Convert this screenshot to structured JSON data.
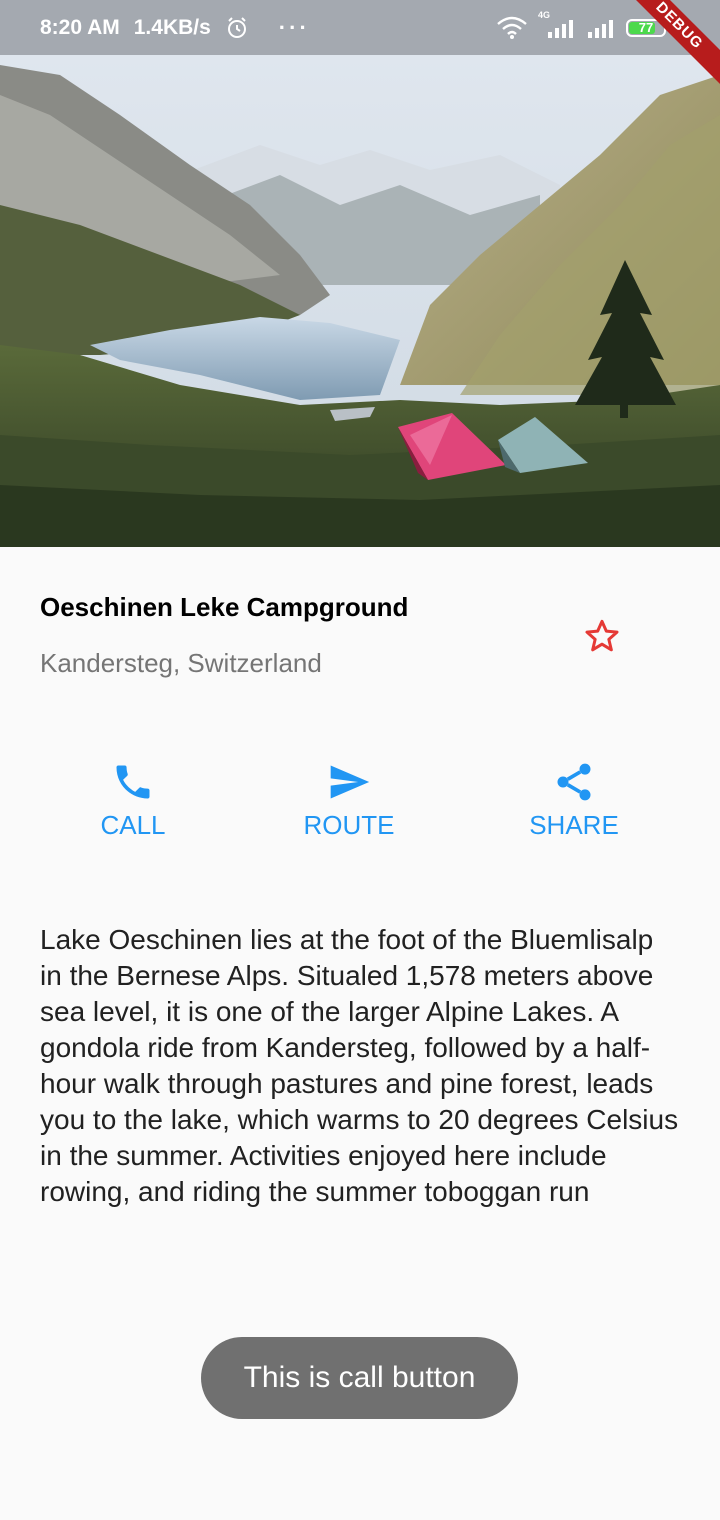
{
  "status_bar": {
    "time": "8:20 AM",
    "network_speed": "1.4KB/s",
    "more_indicator": "···",
    "battery_level": "77",
    "battery_fraction": 0.77,
    "network_type": "4G",
    "debug_banner": "DEBUG",
    "icons": [
      "alarm-icon",
      "wifi-icon",
      "signal-icon",
      "battery-icon",
      "charging-icon"
    ]
  },
  "place": {
    "title": "Oeschinen Leke Campground",
    "location": "Kandersteg, Switzerland",
    "favorite_icon": "star-outline-icon"
  },
  "actions": [
    {
      "label": "CALL",
      "icon": "phone-icon"
    },
    {
      "label": "ROUTE",
      "icon": "send-icon"
    },
    {
      "label": "SHARE",
      "icon": "share-icon"
    }
  ],
  "description": "Lake Oeschinen lies at the foot of the Bluemlisalp in the Bernese Alps. Situaled 1,578 meters above sea level, it is one of the larger Alpine Lakes. A gondola ride from Kandersteg, followed by a half-hour walk through pastures and pine forest, leads you to the lake, which warms to 20 degrees Celsius in the summer. Activities enjoyed here include rowing, and riding the summer toboggan run",
  "toast": "This is call button",
  "colors": {
    "accent": "#2196f3",
    "star": "#e53935",
    "status_bar": "#a4a9b0",
    "toast_bg": "#707070",
    "battery": "#4cd94c"
  }
}
